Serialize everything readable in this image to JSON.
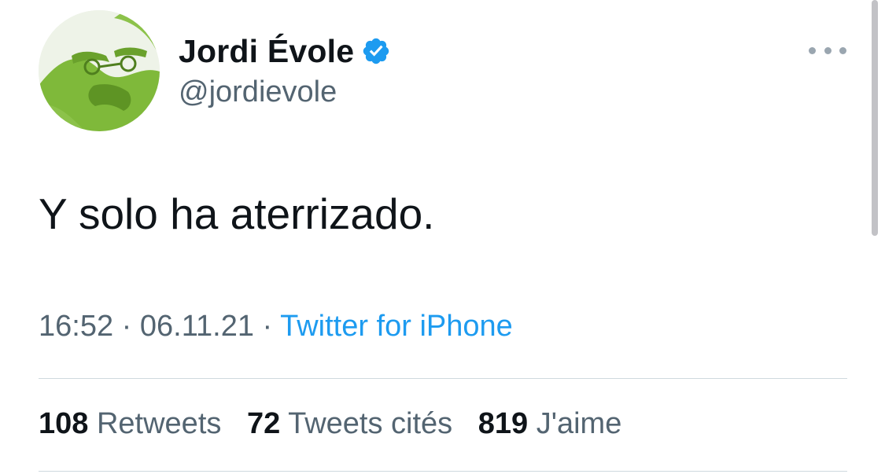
{
  "author": {
    "display_name": "Jordi Évole",
    "handle": "@jordievole",
    "verified": true,
    "avatar_icon": "avatar-portrait"
  },
  "tweet": {
    "text": "Y solo ha aterrizado.",
    "time": "16:52",
    "date": "06.11.21",
    "separator": "·",
    "source": "Twitter for iPhone"
  },
  "stats": {
    "retweets": {
      "count": "108",
      "label": "Retweets"
    },
    "quotes": {
      "count": "72",
      "label": "Tweets cités"
    },
    "likes": {
      "count": "819",
      "label": "J'aime"
    }
  },
  "colors": {
    "text": "#0f1419",
    "secondary": "#536471",
    "link": "#1d9bf0",
    "verified": "#1d9bf0",
    "divider": "#cfd9de",
    "avatar_green": "#7fb93a"
  },
  "icons": {
    "verified": "verified-badge-icon",
    "more": "more-options-icon"
  }
}
